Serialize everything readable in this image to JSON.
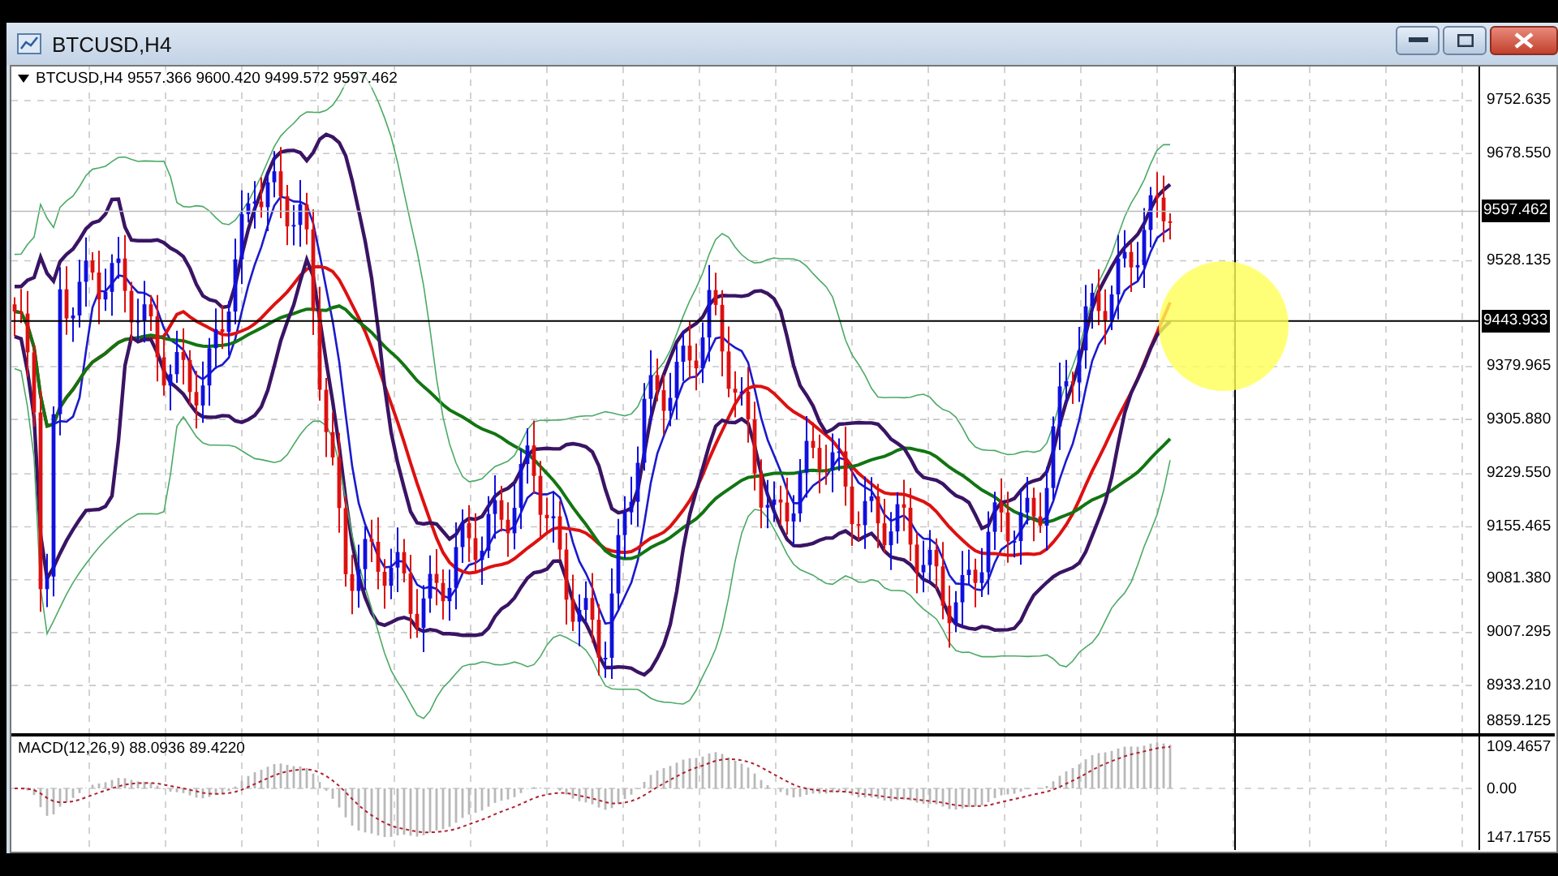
{
  "window": {
    "title": "BTCUSD,H4"
  },
  "legend": {
    "text": "BTCUSD,H4  9557.366 9600.420 9499.572 9597.462"
  },
  "price_axis": {
    "ticks": [
      "9752.635",
      "9678.550",
      "9528.135",
      "9379.965",
      "9305.880",
      "9229.550",
      "9155.465",
      "9081.380",
      "9007.295",
      "8933.210",
      "8859.125"
    ],
    "current_price": "9597.462",
    "crosshair_price": "9443.933"
  },
  "macd": {
    "label": "MACD(12,26,9) 88.0936 89.4220",
    "ticks": [
      "109.4657",
      "0.00",
      "147.1755"
    ]
  }
}
